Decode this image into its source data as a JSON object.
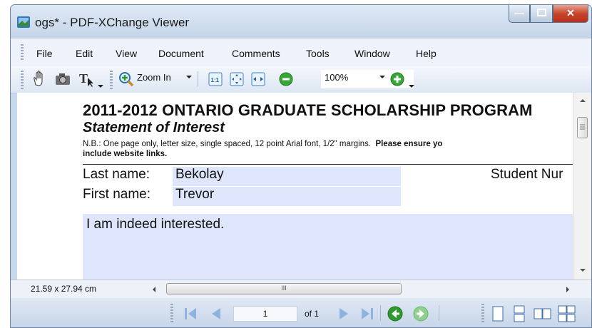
{
  "window": {
    "title": "ogs* - PDF-XChange Viewer"
  },
  "menu": [
    "File",
    "Edit",
    "View",
    "Document",
    "Comments",
    "Tools",
    "Window",
    "Help"
  ],
  "toolbar": {
    "zoom_in_label": "Zoom In",
    "zoom_value": "100%"
  },
  "document": {
    "heading": "2011-2012 ONTARIO GRADUATE SCHOLARSHIP PROGRAM",
    "subheading": "Statement of Interest",
    "note_line1_plain": "N.B.: One page only, letter size, single spaced, 12 point Arial font, 1/2\" margins.",
    "note_line1_bold": "Please ensure yo",
    "note_line2": "include website links.",
    "last_name_label": "Last name:",
    "last_name_value": "Bekolay",
    "first_name_label": "First name:",
    "first_name_value": "Trevor",
    "student_number_label": "Student Nur",
    "statement_text": "I am indeed interested."
  },
  "status": {
    "page_size": "21.59 x 27.94 cm",
    "hscroll_grip": "III"
  },
  "navigation": {
    "current_page": "1",
    "page_count_label": "of 1"
  },
  "colors": {
    "field_fill": "#dfe5fb",
    "title_bar": "#c4d5ea",
    "close_button": "#c8452c"
  }
}
